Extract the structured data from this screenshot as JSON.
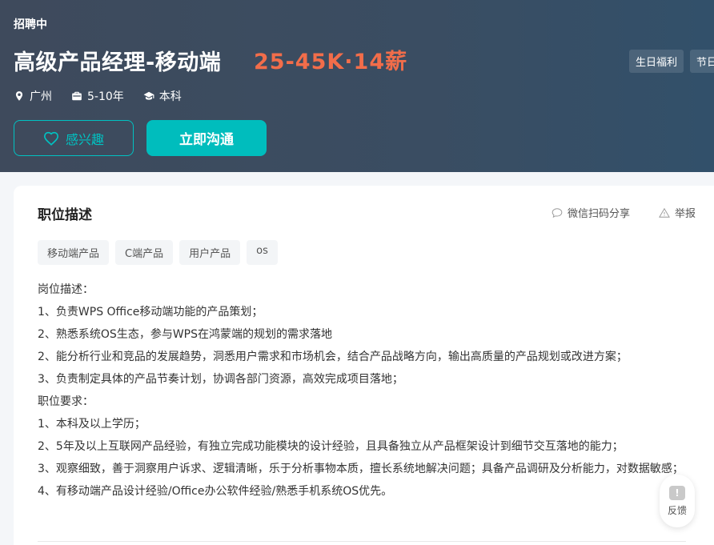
{
  "header": {
    "status": "招聘中",
    "title": "高级产品经理-移动端",
    "salary": "25-45K·14薪",
    "benefits": [
      "生日福利",
      "节日福利"
    ],
    "meta": {
      "location": "广州",
      "experience": "5-10年",
      "education": "本科"
    },
    "interest_label": "感兴趣",
    "chat_label": "立即沟通"
  },
  "colors": {
    "accent": "#00bdbd",
    "salary": "#f26d4a",
    "header_bg": "#3e4a5c"
  },
  "card": {
    "title": "职位描述",
    "share_label": "微信扫码分享",
    "report_label": "举报",
    "tags": [
      "移动端产品",
      "C端产品",
      "用户产品",
      "os"
    ],
    "description_lines": [
      "岗位描述：",
      "1、负责WPS Office移动端功能的产品策划；",
      "2、熟悉系统OS生态，参与WPS在鸿蒙端的规划的需求落地",
      "2、能分析行业和竞品的发展趋势，洞悉用户需求和市场机会，结合产品战略方向，输出高质量的产品规划或改进方案；",
      "3、负责制定具体的产品节奏计划，协调各部门资源，高效完成项目落地；",
      "职位要求：",
      "1、本科及以上学历；",
      "2、5年及以上互联网产品经验，有独立完成功能模块的设计经验，且具备独立从产品框架设计到细节交互落地的能力；",
      "3、观察细致，善于洞察用户诉求、逻辑清晰，乐于分析事物本质，擅长系统地解决问题；具备产品调研及分析能力，对数据敏感；",
      "4、有移动端产品设计经验/Office办公软件经验/熟悉手机系统OS优先。"
    ]
  },
  "feedback": {
    "label": "反馈",
    "icon_glyph": "!"
  }
}
